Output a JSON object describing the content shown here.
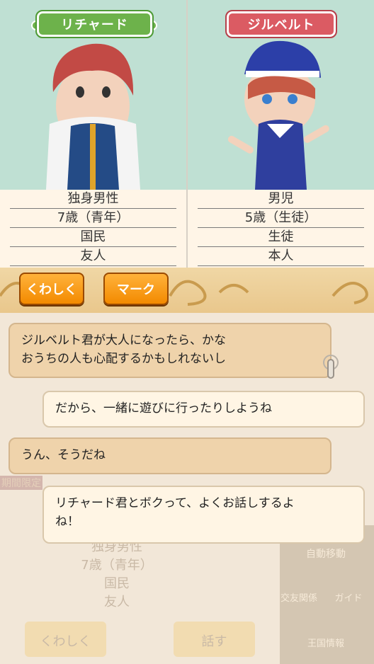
{
  "left_character": {
    "name": "リチャード",
    "info": [
      "独身男性",
      "7歳（青年）",
      "国民",
      "友人"
    ]
  },
  "right_character": {
    "name": "ジルベルト",
    "info": [
      "男児",
      "5歳（生徒）",
      "生徒",
      "本人"
    ]
  },
  "buttons": {
    "details": "くわしく",
    "mark": "マーク"
  },
  "messages": [
    {
      "speaker": "left",
      "text": "ジルベルト君が大人になったら、かな\nおうちの人も心配するかもしれないし"
    },
    {
      "speaker": "right",
      "text": "だから、一緒に遊びに行ったりしようね"
    },
    {
      "speaker": "left",
      "text": "うん、そうだね"
    },
    {
      "speaker": "right",
      "text": "リチャード君とボクって、よくお話しするよ\nね！"
    }
  ],
  "background": {
    "badge": "期間限定",
    "info": [
      "独身男性",
      "7歳（青年）",
      "国民",
      "友人"
    ],
    "buttons": [
      "くわしく",
      "話す"
    ],
    "menu": [
      "自動移動",
      "交友関係",
      "ガイド",
      "王国情報"
    ]
  },
  "colors": {
    "left_name": "#6db24b",
    "right_name": "#db5b63",
    "button": "#f59a10"
  }
}
